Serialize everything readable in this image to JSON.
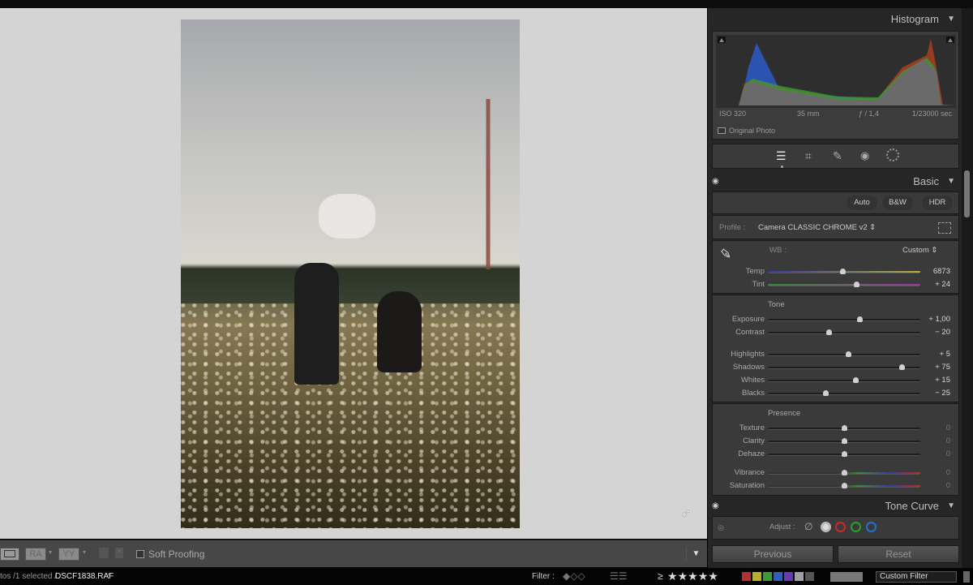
{
  "toolbar": {
    "soft_proofing": "Soft Proofing",
    "view_buttons": [
      "RA",
      "YY"
    ]
  },
  "statusbar": {
    "breadcrumb": "tos /1 selected /",
    "filename": "DSCF1838.RAF",
    "filter_label": "Filter :",
    "rating_op": "≥",
    "stars": 5,
    "filter_preset": "Custom Filter",
    "label_colors": [
      "#b53030",
      "#b5b030",
      "#3a9a3a",
      "#2e5fb5",
      "#6a3ab5",
      "#a0a0a0",
      "#555555"
    ]
  },
  "histogram": {
    "title": "Histogram",
    "iso": "ISO 320",
    "focal": "35 mm",
    "aperture": "ƒ / 1,4",
    "shutter": "1/23000 sec",
    "original_photo": "Original Photo"
  },
  "tools": [
    "edit-icon",
    "crop-icon",
    "heal-icon",
    "redeye-icon",
    "mask-icon"
  ],
  "basic": {
    "title": "Basic",
    "buttons": [
      "Auto",
      "B&W",
      "HDR"
    ],
    "profile_label": "Profile :",
    "profile": "Camera CLASSIC CHROME v2 ⇕",
    "wb_label": "WB :",
    "wb_value": "Custom ⇕",
    "wb_sliders": [
      {
        "label": "Temp",
        "value": "6873",
        "pos": 0.49,
        "gradient": "linear-gradient(90deg,#3a3aa0,#b0b040)"
      },
      {
        "label": "Tint",
        "value": "+ 24",
        "pos": 0.58,
        "gradient": "linear-gradient(90deg,#3a8a3a,#a03aa0)"
      }
    ],
    "tone_label": "Tone",
    "tone_sliders": [
      {
        "label": "Exposure",
        "value": "+ 1,00",
        "pos": 0.6
      },
      {
        "label": "Contrast",
        "value": "− 20",
        "pos": 0.4
      }
    ],
    "tone_sliders2": [
      {
        "label": "Highlights",
        "value": "+ 5",
        "pos": 0.525
      },
      {
        "label": "Shadows",
        "value": "+ 75",
        "pos": 0.875
      },
      {
        "label": "Whites",
        "value": "+ 15",
        "pos": 0.575
      },
      {
        "label": "Blacks",
        "value": "− 25",
        "pos": 0.375
      }
    ],
    "presence_label": "Presence",
    "presence_sliders": [
      {
        "label": "Texture",
        "value": "0",
        "pos": 0.5
      },
      {
        "label": "Clarity",
        "value": "0",
        "pos": 0.5
      },
      {
        "label": "Dehaze",
        "value": "0",
        "pos": 0.5
      }
    ],
    "color_sliders": [
      {
        "label": "Vibrance",
        "value": "0",
        "pos": 0.5
      },
      {
        "label": "Saturation",
        "value": "0",
        "pos": 0.5
      }
    ]
  },
  "tone_curve": {
    "title": "Tone Curve",
    "adjust_label": "Adjust :"
  },
  "footer": {
    "previous": "Previous",
    "reset": "Reset"
  }
}
